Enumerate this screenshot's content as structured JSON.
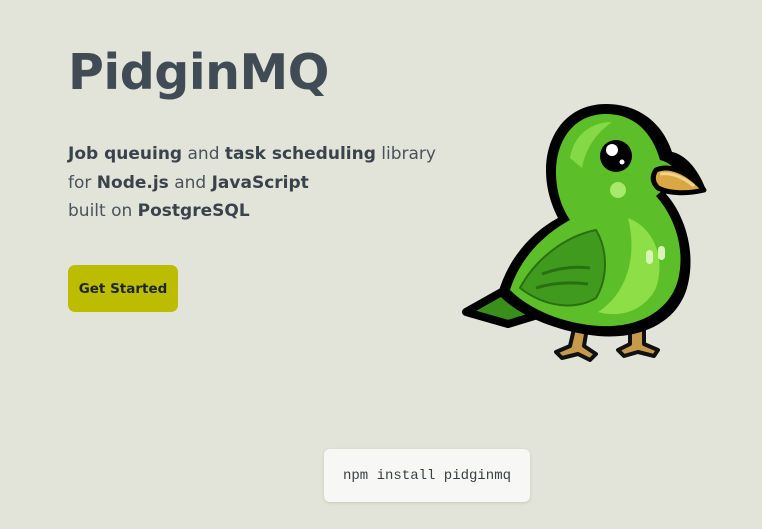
{
  "hero": {
    "title": "PidginMQ",
    "tagline": {
      "line1": [
        {
          "text": "Job queuing",
          "bold": true
        },
        {
          "text": " and ",
          "bold": false
        },
        {
          "text": "task scheduling",
          "bold": true
        },
        {
          "text": " library",
          "bold": false
        }
      ],
      "line2": [
        {
          "text": "for ",
          "bold": false
        },
        {
          "text": "Node.js",
          "bold": true
        },
        {
          "text": " and ",
          "bold": false
        },
        {
          "text": "JavaScript",
          "bold": true
        }
      ],
      "line3": [
        {
          "text": "built on ",
          "bold": false
        },
        {
          "text": "PostgreSQL",
          "bold": true
        }
      ]
    },
    "cta_label": "Get Started",
    "mascot_icon": "green-bird-mascot-icon"
  },
  "install": {
    "command": "npm install pidginmq"
  },
  "colors": {
    "background": "#e2e4d9",
    "title": "#414b55",
    "cta_background": "#bcbd00",
    "bird_green": "#5cbf2a",
    "bird_beak": "#d9a845"
  }
}
